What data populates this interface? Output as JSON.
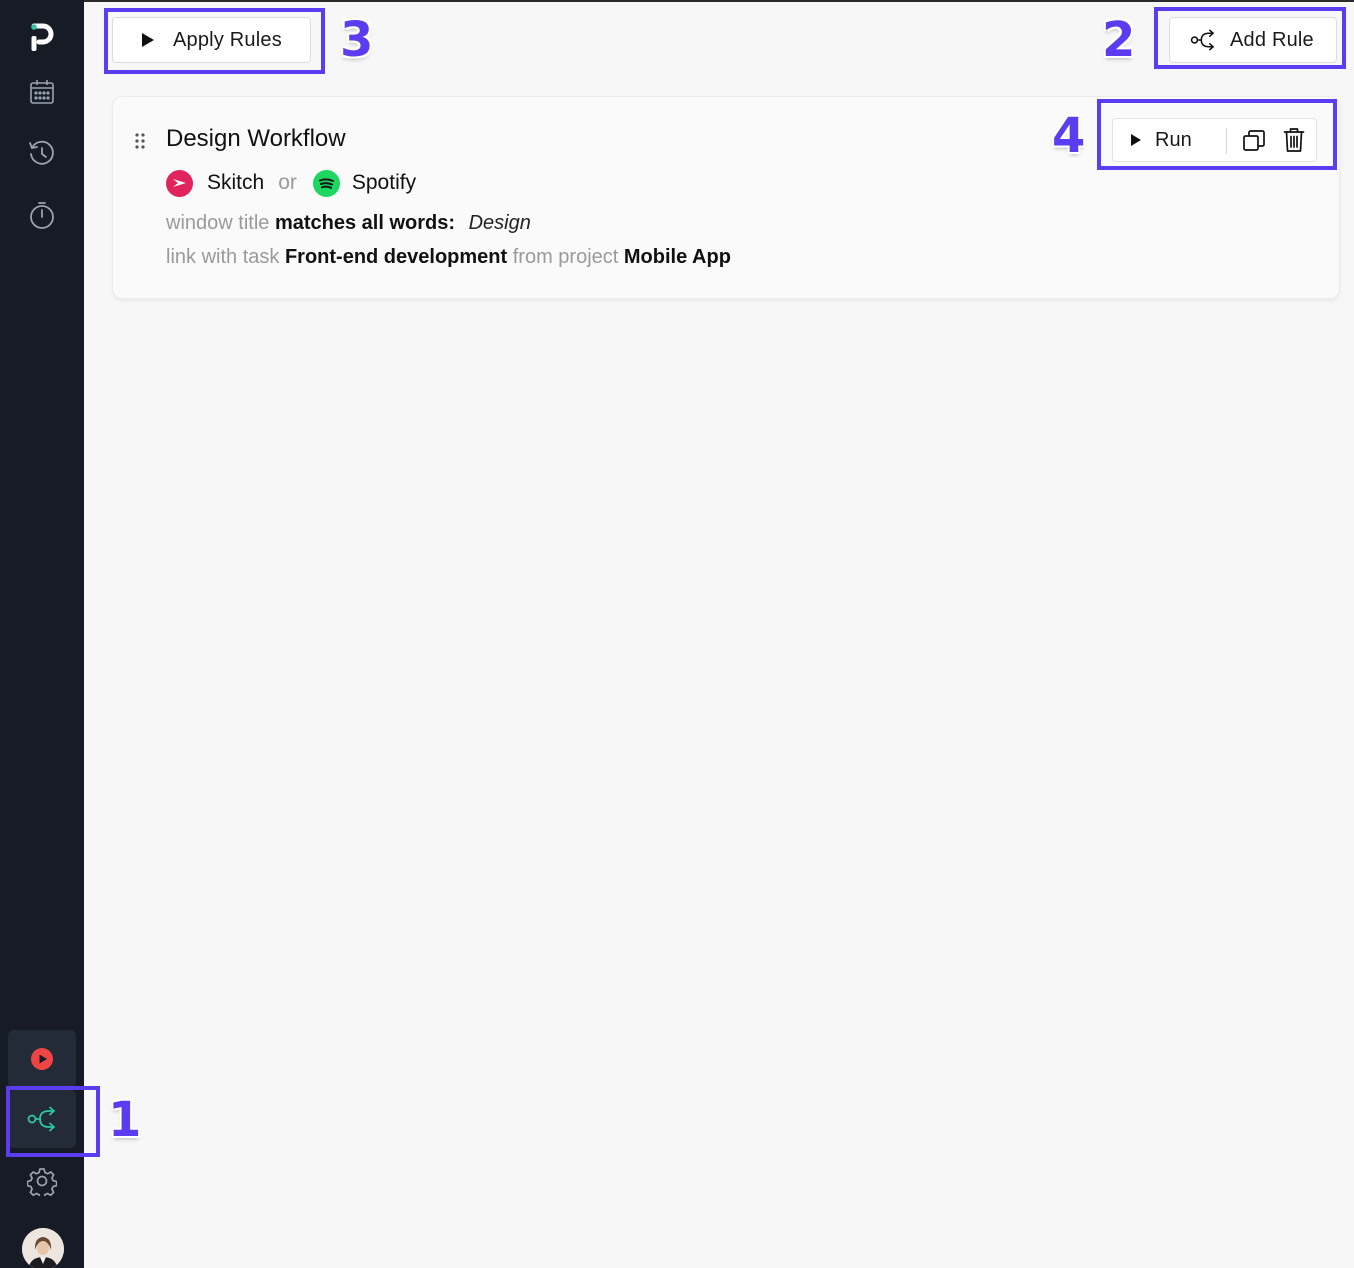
{
  "sidebar": {
    "logo_icon": "p-logo",
    "items": [
      "calendar-icon",
      "history-icon",
      "timer-icon"
    ],
    "bottom": [
      "record-icon",
      "rules-icon",
      "settings-icon"
    ],
    "record_color": "#ef4444",
    "rules_color": "#2ec4a6"
  },
  "toolbar": {
    "apply_label": "Apply Rules",
    "add_label": "Add Rule"
  },
  "rule": {
    "title": "Design Workflow",
    "app1": "Skitch",
    "or": "or",
    "app2": "Spotify",
    "cond_prefix": "window title",
    "cond_op": "matches all words:",
    "cond_value": "Design",
    "link_prefix": "link with task",
    "task": "Front-end development",
    "from": "from project",
    "project": "Mobile App",
    "run_label": "Run"
  },
  "annotations": [
    "1",
    "2",
    "3",
    "4"
  ],
  "colors": {
    "highlight": "#5b3cf0",
    "skitch": "#e0245e",
    "spotify": "#1ed760"
  }
}
